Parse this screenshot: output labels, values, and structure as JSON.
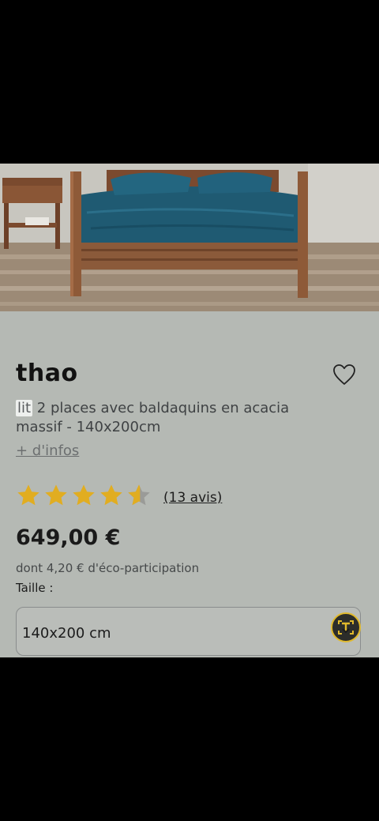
{
  "product": {
    "brand": "thao",
    "description_highlight": "lit",
    "description_rest": " 2 places avec baldaquins en acacia massif - 140x200cm",
    "more_link": "+ d'infos",
    "rating": 4.5,
    "rating_max": 5,
    "reviews_label": "(13 avis)",
    "price": "649,00 €",
    "eco_participation": "dont 4,20 € d'éco-participation",
    "size_label": "Taille :",
    "size_value": "140x200 cm"
  },
  "colors": {
    "page_bg": "#b5b9b4",
    "star": "#e1ad21",
    "star_empty": "#9a9b98",
    "lens_accent": "#e0b92c"
  },
  "icons": {
    "favorite": "heart-outline-icon",
    "lens": "text-lens-icon"
  }
}
